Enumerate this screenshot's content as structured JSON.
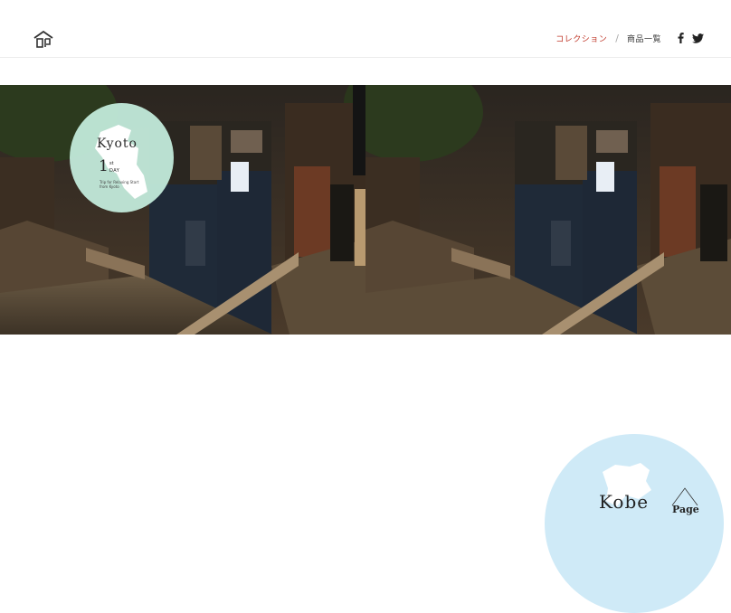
{
  "header": {
    "logo_icon": "house-seal-logo-icon",
    "nav": {
      "collection_label": "コレクション",
      "separator": "/",
      "products_label": "商品一覧"
    },
    "social": {
      "facebook_icon": "facebook-icon",
      "twitter_icon": "twitter-icon"
    },
    "accent_color": "#c0392b"
  },
  "banner": {
    "image_description_icon": "kyoto-alley-night-photo",
    "kyoto_badge": {
      "title": "Kyoto",
      "day_number": "1",
      "day_suffix": "st",
      "day_label": "DAY",
      "tagline": "Trip for Relaxing Start from Kyoto",
      "badge_color": "#c4ecdc"
    }
  },
  "kobe_badge": {
    "title": "Kobe",
    "page_label": "Page",
    "badge_color": "#cfeaf7"
  }
}
